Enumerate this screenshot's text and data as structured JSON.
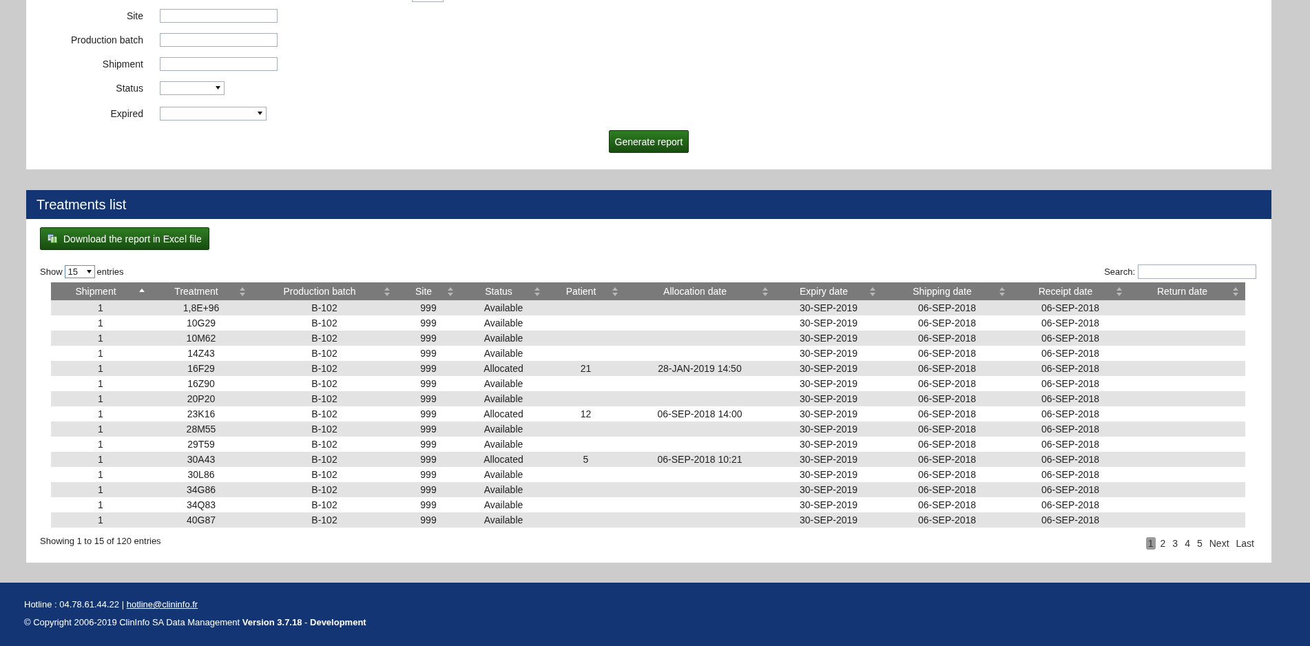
{
  "filters": [
    {
      "label": "Site",
      "kind": "text"
    },
    {
      "label": "Production batch",
      "kind": "text"
    },
    {
      "label": "Shipment",
      "kind": "text"
    },
    {
      "label": "Status",
      "kind": "select"
    },
    {
      "label": "Expired",
      "kind": "select-wide"
    }
  ],
  "generate_button": "Generate report",
  "panel": {
    "title": "Treatments list",
    "download_button": "Download the report in Excel file",
    "length": {
      "before": "Show",
      "value": "15",
      "after": "entries"
    },
    "search": {
      "label": "Search:"
    },
    "columns": [
      {
        "label": "Shipment",
        "sorted": true
      },
      {
        "label": "Treatment",
        "sorted": false
      },
      {
        "label": "Production batch",
        "sorted": false
      },
      {
        "label": "Site",
        "sorted": false
      },
      {
        "label": "Status",
        "sorted": false
      },
      {
        "label": "Patient",
        "sorted": false
      },
      {
        "label": "Allocation date",
        "sorted": false
      },
      {
        "label": "Expiry date",
        "sorted": false
      },
      {
        "label": "Shipping date",
        "sorted": false
      },
      {
        "label": "Receipt date",
        "sorted": false
      },
      {
        "label": "Return date",
        "sorted": false
      }
    ],
    "rows": [
      [
        "1",
        "1,8E+96",
        "B-102",
        "999",
        "Available",
        "",
        "",
        "30-SEP-2019",
        "06-SEP-2018",
        "06-SEP-2018",
        ""
      ],
      [
        "1",
        "10G29",
        "B-102",
        "999",
        "Available",
        "",
        "",
        "30-SEP-2019",
        "06-SEP-2018",
        "06-SEP-2018",
        ""
      ],
      [
        "1",
        "10M62",
        "B-102",
        "999",
        "Available",
        "",
        "",
        "30-SEP-2019",
        "06-SEP-2018",
        "06-SEP-2018",
        ""
      ],
      [
        "1",
        "14Z43",
        "B-102",
        "999",
        "Available",
        "",
        "",
        "30-SEP-2019",
        "06-SEP-2018",
        "06-SEP-2018",
        ""
      ],
      [
        "1",
        "16F29",
        "B-102",
        "999",
        "Allocated",
        "21",
        "28-JAN-2019 14:50",
        "30-SEP-2019",
        "06-SEP-2018",
        "06-SEP-2018",
        ""
      ],
      [
        "1",
        "16Z90",
        "B-102",
        "999",
        "Available",
        "",
        "",
        "30-SEP-2019",
        "06-SEP-2018",
        "06-SEP-2018",
        ""
      ],
      [
        "1",
        "20P20",
        "B-102",
        "999",
        "Available",
        "",
        "",
        "30-SEP-2019",
        "06-SEP-2018",
        "06-SEP-2018",
        ""
      ],
      [
        "1",
        "23K16",
        "B-102",
        "999",
        "Allocated",
        "12",
        "06-SEP-2018 14:00",
        "30-SEP-2019",
        "06-SEP-2018",
        "06-SEP-2018",
        ""
      ],
      [
        "1",
        "28M55",
        "B-102",
        "999",
        "Available",
        "",
        "",
        "30-SEP-2019",
        "06-SEP-2018",
        "06-SEP-2018",
        ""
      ],
      [
        "1",
        "29T59",
        "B-102",
        "999",
        "Available",
        "",
        "",
        "30-SEP-2019",
        "06-SEP-2018",
        "06-SEP-2018",
        ""
      ],
      [
        "1",
        "30A43",
        "B-102",
        "999",
        "Allocated",
        "5",
        "06-SEP-2018 10:21",
        "30-SEP-2019",
        "06-SEP-2018",
        "06-SEP-2018",
        ""
      ],
      [
        "1",
        "30L86",
        "B-102",
        "999",
        "Available",
        "",
        "",
        "30-SEP-2019",
        "06-SEP-2018",
        "06-SEP-2018",
        ""
      ],
      [
        "1",
        "34G86",
        "B-102",
        "999",
        "Available",
        "",
        "",
        "30-SEP-2019",
        "06-SEP-2018",
        "06-SEP-2018",
        ""
      ],
      [
        "1",
        "34Q83",
        "B-102",
        "999",
        "Available",
        "",
        "",
        "30-SEP-2019",
        "06-SEP-2018",
        "06-SEP-2018",
        ""
      ],
      [
        "1",
        "40G87",
        "B-102",
        "999",
        "Available",
        "",
        "",
        "30-SEP-2019",
        "06-SEP-2018",
        "06-SEP-2018",
        ""
      ]
    ],
    "info": "Showing 1 to 15 of 120 entries",
    "pages": [
      {
        "label": "1",
        "selected": true
      },
      {
        "label": "2",
        "selected": false
      },
      {
        "label": "3",
        "selected": false
      },
      {
        "label": "4",
        "selected": false
      },
      {
        "label": "5",
        "selected": false
      }
    ],
    "next": "Next",
    "last": "Last"
  },
  "footer": {
    "hotline": "Hotline : 04.78.61.44.22 |",
    "email": "hotline@clininfo.fr",
    "copyright": "© Copyright 2006-2019 ClinInfo SA Data Management **Version 3.7.18** - **Development**"
  }
}
